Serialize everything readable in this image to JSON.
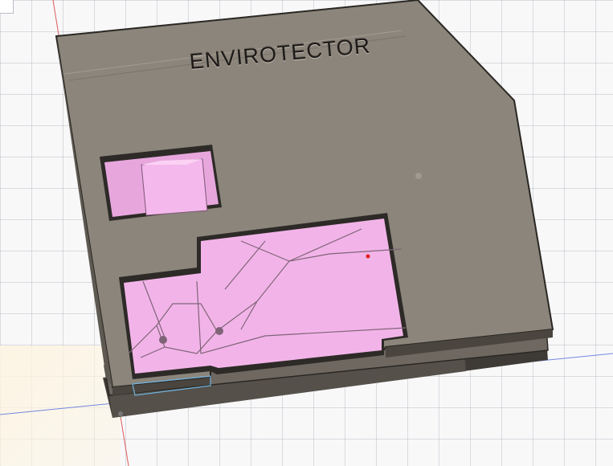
{
  "model": {
    "engraved_text": "ENVIROTECTOR",
    "colors": {
      "lid": "#8b857b",
      "lid_edge": "#5e5951",
      "interior": "#f2b4e8",
      "axis_red": "#e04040",
      "axis_blue": "#6f86e0",
      "axis_green": "#4fb84f"
    }
  }
}
